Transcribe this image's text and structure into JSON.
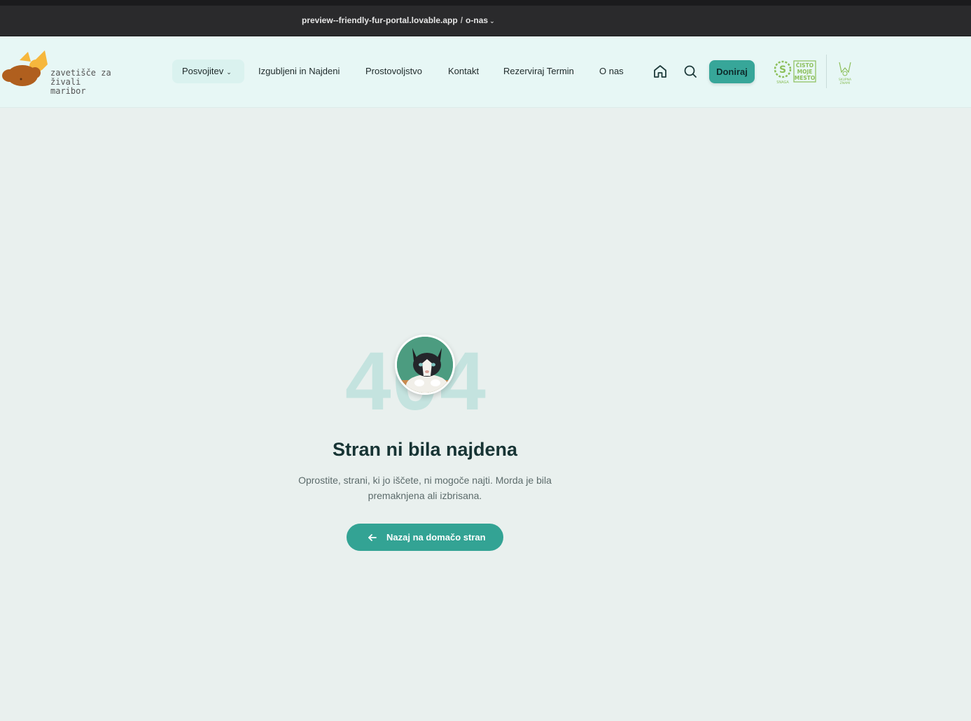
{
  "browser": {
    "url_host": "preview--friendly-fur-portal.lovable.app",
    "url_sep": "/",
    "url_path": "o-nas",
    "chevron": "⌄"
  },
  "logo": {
    "line1": "zavetišče za živali",
    "line2": "maribor",
    "colors": {
      "brown": "#b05f1e",
      "yellow": "#f6b73c"
    }
  },
  "nav": {
    "items": [
      {
        "label": "Posvojitev",
        "has_dropdown": true
      },
      {
        "label": "Izgubljeni in Najdeni"
      },
      {
        "label": "Prostovoljstvo"
      },
      {
        "label": "Kontakt"
      },
      {
        "label": "Rezerviraj Termin"
      },
      {
        "label": "O nas"
      }
    ],
    "icons": [
      "home-icon",
      "search-icon"
    ],
    "donate_label": "Doniraj"
  },
  "partners": {
    "p1_small": "SNAGA",
    "p1_l1": "ČISTO",
    "p1_l2": "MOJE",
    "p1_l3": "MESTO",
    "p2_small": "SKUPNA\nZNAMI"
  },
  "error": {
    "code": "404",
    "title": "Stran ni bila najdena",
    "description": "Oprostite, strani, ki jo iščete, ni mogoče najti. Morda je bila premaknjena ali izbrisana.",
    "button_label": "Nazaj na domačo stran"
  },
  "colors": {
    "accent": "#33a394",
    "header_bg": "#e7f7f5",
    "page_bg": "#e9f0ee",
    "code_color": "#c4e3df"
  }
}
